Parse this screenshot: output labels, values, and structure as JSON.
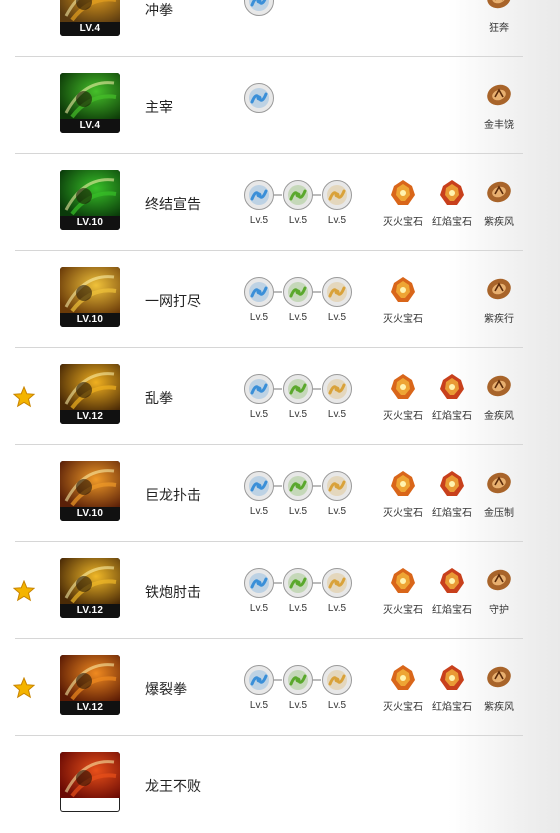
{
  "colors": {
    "blue_rune": "#3a8fd8",
    "green_rune": "#5aa82c",
    "yellow_rune": "#d9a23a",
    "ember": "#d9661a",
    "red_gem": "#c8401c",
    "brown_mark": "#a8642a"
  },
  "rows": [
    {
      "name": "冲拳",
      "level": "LV.4",
      "starred": false,
      "icon": "fist-skill-icon",
      "art": "a1",
      "runes": [
        {
          "color": "blue",
          "level": ""
        }
      ],
      "gems": [],
      "family": {
        "label": "狂奔",
        "icon": "rune-mark-icon"
      }
    },
    {
      "name": "主宰",
      "level": "LV.4",
      "starred": false,
      "icon": "dominion-skill-icon",
      "art": "a2",
      "runes": [
        {
          "color": "blue",
          "level": ""
        }
      ],
      "gems": [],
      "family": {
        "label": "金丰饶",
        "icon": "rune-mark-icon"
      }
    },
    {
      "name": "终结宣告",
      "level": "LV.10",
      "starred": false,
      "icon": "declaration-skill-icon",
      "art": "a3",
      "runes": [
        {
          "color": "blue",
          "level": "Lv.5"
        },
        {
          "color": "green",
          "level": "Lv.5"
        },
        {
          "color": "yellow",
          "level": "Lv.5"
        }
      ],
      "gems": [
        {
          "label": "灭火宝石",
          "kind": "ember"
        },
        {
          "label": "红焰宝石",
          "kind": "red"
        }
      ],
      "family": {
        "label": "紫疾风",
        "icon": "rune-mark-icon"
      }
    },
    {
      "name": "一网打尽",
      "level": "LV.10",
      "starred": false,
      "icon": "sweep-skill-icon",
      "art": "a4",
      "runes": [
        {
          "color": "blue",
          "level": "Lv.5"
        },
        {
          "color": "green",
          "level": "Lv.5"
        },
        {
          "color": "yellow",
          "level": "Lv.5"
        }
      ],
      "gems": [
        {
          "label": "灭火宝石",
          "kind": "ember"
        }
      ],
      "family": {
        "label": "紫疾行",
        "icon": "rune-mark-icon"
      }
    },
    {
      "name": "乱拳",
      "level": "LV.12",
      "starred": true,
      "icon": "flurry-skill-icon",
      "art": "a5",
      "runes": [
        {
          "color": "blue",
          "level": "Lv.5"
        },
        {
          "color": "green",
          "level": "Lv.5"
        },
        {
          "color": "yellow",
          "level": "Lv.5"
        }
      ],
      "gems": [
        {
          "label": "灭火宝石",
          "kind": "ember"
        },
        {
          "label": "红焰宝石",
          "kind": "red"
        }
      ],
      "family": {
        "label": "金疾风",
        "icon": "rune-mark-icon"
      }
    },
    {
      "name": "巨龙扑击",
      "level": "LV.10",
      "starred": false,
      "icon": "dragon-pounce-skill-icon",
      "art": "a6",
      "runes": [
        {
          "color": "blue",
          "level": "Lv.5"
        },
        {
          "color": "green",
          "level": "Lv.5"
        },
        {
          "color": "yellow",
          "level": "Lv.5"
        }
      ],
      "gems": [
        {
          "label": "灭火宝石",
          "kind": "ember"
        },
        {
          "label": "红焰宝石",
          "kind": "red"
        }
      ],
      "family": {
        "label": "金压制",
        "icon": "rune-mark-icon"
      }
    },
    {
      "name": "铁炮肘击",
      "level": "LV.12",
      "starred": true,
      "icon": "cannon-elbow-skill-icon",
      "art": "a7",
      "runes": [
        {
          "color": "blue",
          "level": "Lv.5"
        },
        {
          "color": "green",
          "level": "Lv.5"
        },
        {
          "color": "yellow",
          "level": "Lv.5"
        }
      ],
      "gems": [
        {
          "label": "灭火宝石",
          "kind": "ember"
        },
        {
          "label": "红焰宝石",
          "kind": "red"
        }
      ],
      "family": {
        "label": "守护",
        "icon": "rune-mark-icon"
      }
    },
    {
      "name": "爆裂拳",
      "level": "LV.12",
      "starred": true,
      "icon": "burst-fist-skill-icon",
      "art": "a8",
      "runes": [
        {
          "color": "blue",
          "level": "Lv.5"
        },
        {
          "color": "green",
          "level": "Lv.5"
        },
        {
          "color": "yellow",
          "level": "Lv.5"
        }
      ],
      "gems": [
        {
          "label": "灭火宝石",
          "kind": "ember"
        },
        {
          "label": "红焰宝石",
          "kind": "red"
        }
      ],
      "family": {
        "label": "紫疾风",
        "icon": "rune-mark-icon"
      }
    },
    {
      "name": "龙王不败",
      "level": "",
      "starred": false,
      "icon": "dragon-king-skill-icon",
      "art": "a9",
      "runes": [],
      "gems": [],
      "family": null
    }
  ]
}
